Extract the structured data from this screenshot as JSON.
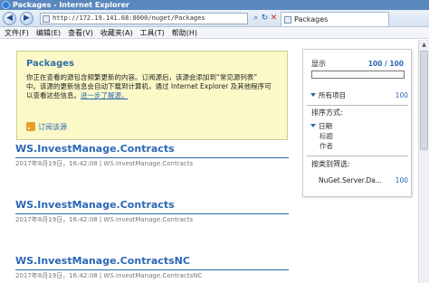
{
  "window": {
    "title": "Packages - Internet Explorer"
  },
  "address": {
    "url": "http://172.19.141.68:8000/nuget/Packages",
    "tab_label": "Packages"
  },
  "menu": [
    "文件(F)",
    "编辑(E)",
    "查看(V)",
    "收藏夹(A)",
    "工具(T)",
    "帮助(H)"
  ],
  "info": {
    "title": "Packages",
    "body_line1": "你正在查看的源包含频繁更新的内容。订阅源后，该源会添加到“常见源列表”",
    "body_line2": "中。该源的更新信息会自动下载到计算机，通过 Internet Explorer 及其他程序可",
    "body_line3_prefix": "以查看这些信息。",
    "learn_more": "进一步了解源。",
    "subscribe": "订阅该源"
  },
  "packages": [
    {
      "title": "WS.InvestManage.Contracts",
      "meta": "2017年8月19日，16:42:08 | WS.InvestManage.Contracts"
    },
    {
      "title": "WS.InvestManage.Contracts",
      "meta": "2017年8月19日，16:42:08 | WS.InvestManage.Contracts"
    },
    {
      "title": "WS.InvestManage.ContractsNC",
      "meta": "2017年8月19日，16:42:08 | WS.InvestManage.ContractsNC"
    }
  ],
  "panel": {
    "display_label": "显示",
    "display_count": "100 / 100",
    "all_items_label": "所有项目",
    "all_items_count": "100",
    "sort_label": "排序方式:",
    "sort_options": [
      "日期",
      "标题",
      "作者"
    ],
    "filter_label": "按类别筛选:",
    "filter_item_label": "NuGet.Server.Da...",
    "filter_item_count": "100"
  }
}
